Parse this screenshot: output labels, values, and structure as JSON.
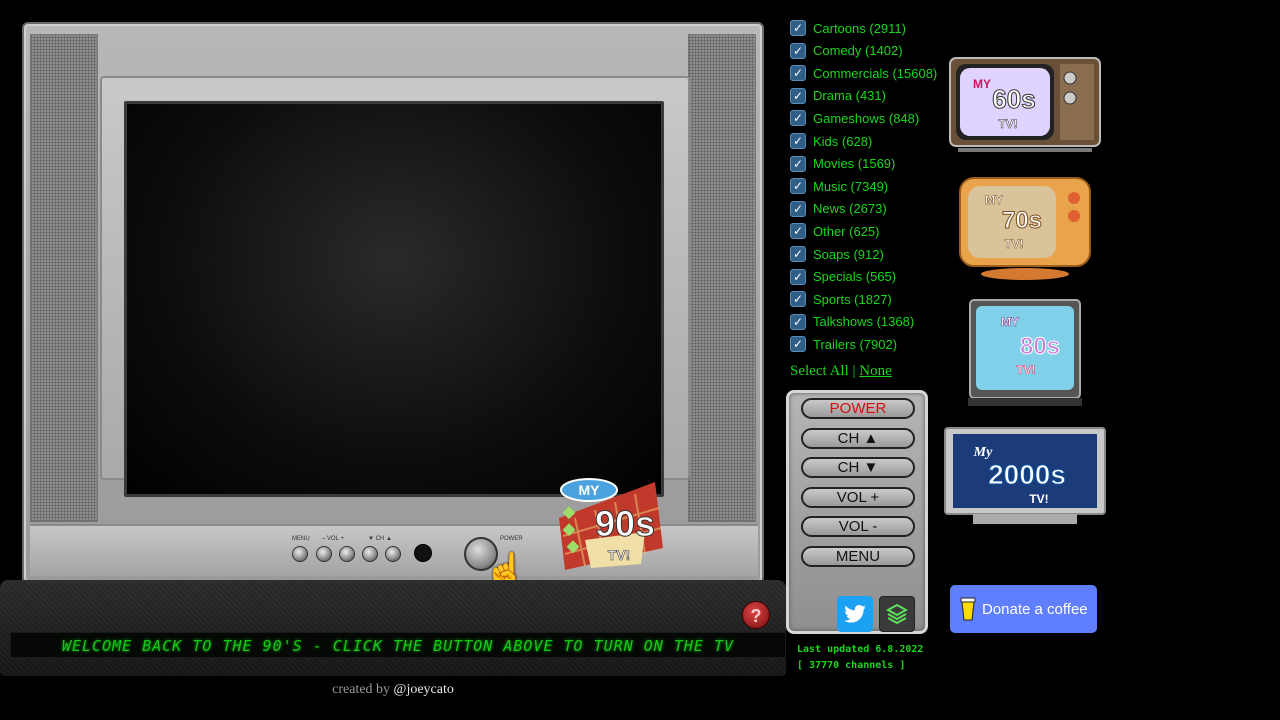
{
  "ticker": {
    "text": "WELCOME BACK TO THE 90'S - CLICK THE BUTTON ABOVE TO TURN ON THE TV"
  },
  "tv": {
    "button_labels": {
      "menu": "MENU",
      "vol": "– VOL +",
      "ch": "▼ CH ▲",
      "power": "POWER"
    },
    "logo": {
      "my": "MY",
      "decade": "90s",
      "tv": "TV!"
    }
  },
  "credit": {
    "prefix": "created by",
    "handle": "@joeycato"
  },
  "categories": [
    {
      "label": "Cartoons (2911)",
      "checked": true
    },
    {
      "label": "Comedy (1402)",
      "checked": true
    },
    {
      "label": "Commercials (15608)",
      "checked": true
    },
    {
      "label": "Drama (431)",
      "checked": true
    },
    {
      "label": "Gameshows (848)",
      "checked": true
    },
    {
      "label": "Kids (628)",
      "checked": true
    },
    {
      "label": "Movies (1569)",
      "checked": true
    },
    {
      "label": "Music (7349)",
      "checked": true
    },
    {
      "label": "News (2673)",
      "checked": true
    },
    {
      "label": "Other (625)",
      "checked": true
    },
    {
      "label": "Soaps (912)",
      "checked": true
    },
    {
      "label": "Specials (565)",
      "checked": true
    },
    {
      "label": "Sports (1827)",
      "checked": true
    },
    {
      "label": "Talkshows (1368)",
      "checked": true
    },
    {
      "label": "Trailers (7902)",
      "checked": true
    }
  ],
  "select": {
    "all": "Select All",
    "separator": "|",
    "none": "None"
  },
  "remote": {
    "power": "POWER",
    "ch_up": "CH ▲",
    "ch_down": "CH ▼",
    "vol_up": "VOL +",
    "vol_down": "VOL -",
    "menu": "MENU"
  },
  "update": {
    "line1": "Last updated 6.8.2022",
    "line2": "[ 37770 channels ]"
  },
  "decades": [
    {
      "my": "MY",
      "decade": "60s",
      "tv": "TV!"
    },
    {
      "my": "MY",
      "decade": "70s",
      "tv": "TV!"
    },
    {
      "my": "MY",
      "decade": "80s",
      "tv": "TV!"
    },
    {
      "my": "My",
      "decade": "2000s",
      "tv": "TV!"
    }
  ],
  "donate": {
    "label": "Donate a coffee"
  },
  "colors": {
    "green_text": "#19d719",
    "ticker_green": "#17c817",
    "checkbox": "#2f5e86",
    "donate": "#5f7fff",
    "twitter": "#1da1f2"
  }
}
